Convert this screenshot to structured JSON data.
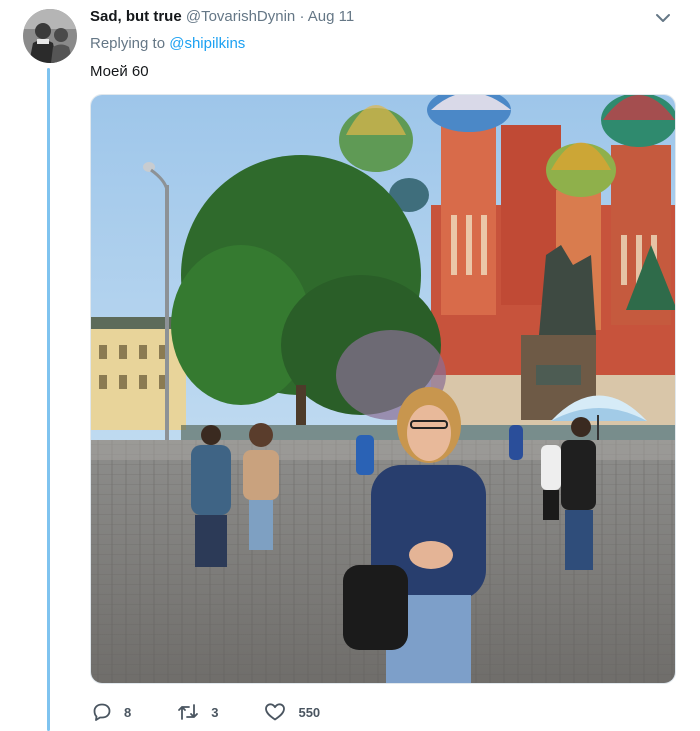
{
  "tweet": {
    "author": {
      "display_name": "Sad, but true",
      "handle": "@TovarishDynin"
    },
    "separator": "·",
    "date": "Aug 11",
    "reply": {
      "prefix": "Replying to ",
      "mention": "@shipilkins"
    },
    "text": "Моей 60",
    "actions": {
      "reply_count": "8",
      "retweet_count": "3",
      "like_count": "550"
    }
  },
  "colors": {
    "accent": "#1da1f2",
    "thread_line": "#7fc3ef",
    "secondary_text": "#657786"
  },
  "icons": [
    "chevron-down-icon",
    "reply-icon",
    "retweet-icon",
    "heart-icon"
  ]
}
